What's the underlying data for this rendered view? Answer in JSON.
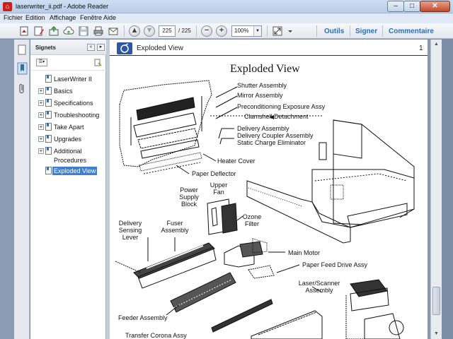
{
  "window": {
    "title": "laserwriter_ii.pdf - Adobe Reader",
    "minimize": "–",
    "maximize": "□",
    "close": "✕"
  },
  "menu": [
    "Fichier",
    "Edition",
    "Affichage",
    "Fenêtre",
    "Aide"
  ],
  "toolbar": {
    "page_current": "225",
    "page_total": "/ 225",
    "zoom": "100%",
    "outils": "Outils",
    "signer": "Signer",
    "commentaire": "Commentaire"
  },
  "bookmarks_panel": {
    "title": "Signets",
    "items": [
      {
        "label": "LaserWriter II",
        "expandable": false,
        "selected": false
      },
      {
        "label": "Basics",
        "expandable": true,
        "selected": false
      },
      {
        "label": "Specifications",
        "expandable": true,
        "selected": false
      },
      {
        "label": "Troubleshooting",
        "expandable": true,
        "selected": false
      },
      {
        "label": "Take Apart",
        "expandable": true,
        "selected": false
      },
      {
        "label": "Upgrades",
        "expandable": true,
        "selected": false
      },
      {
        "label": "Additional",
        "expandable": true,
        "selected": false
      },
      {
        "label": "Procedures",
        "expandable": false,
        "selected": false
      },
      {
        "label": "Exploded View",
        "expandable": false,
        "selected": true
      }
    ]
  },
  "document": {
    "header_title": "Exploded View",
    "page_number": "1",
    "heading": "Exploded View",
    "callouts": {
      "shutter": "Shutter Assembly",
      "mirror": "Mirror Assembly",
      "precond": "Preconditioning Exposure Assy",
      "clamshell": "Clamshell Detachment",
      "delivery1": "Delivery Assembly",
      "delivery2": "Delivery Coupler Assembly",
      "delivery3": "Static Charge Eliminator",
      "heater": "Heater Cover",
      "deflector": "Paper Deflector",
      "power1": "Power",
      "power2": "Supply",
      "power3": "Block",
      "upper1": "Upper",
      "upper2": "Fan",
      "ozone1": "Ozone",
      "ozone2": "Filter",
      "sensing1": "Delivery",
      "sensing2": "Sensing",
      "sensing3": "Lever",
      "fuser1": "Fuser",
      "fuser2": "Assembly",
      "motor": "Main Motor",
      "feeddrive": "Paper Feed Drive Assy",
      "laser1": "Laser/Scanner",
      "laser2": "Assembly",
      "feeder": "Feeder Assembly",
      "transfer": "Transfer Corona Assy"
    }
  },
  "colors": {
    "selection": "#3f7fd1",
    "link": "#2f6db3",
    "close_button": "#c44a2b"
  }
}
